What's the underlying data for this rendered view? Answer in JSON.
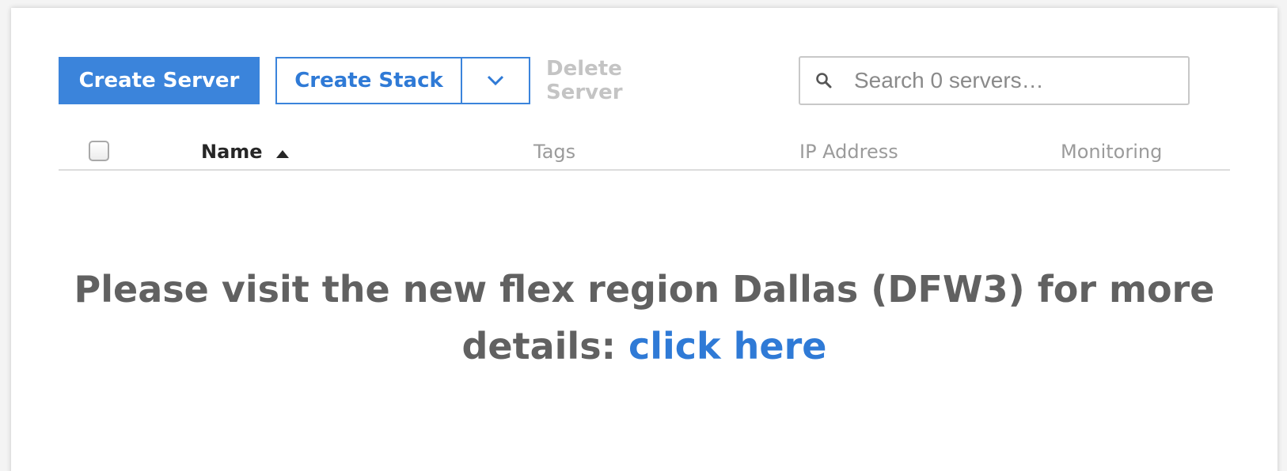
{
  "toolbar": {
    "create_server_label": "Create Server",
    "create_stack_label": "Create Stack",
    "delete_server_label": "Delete Server"
  },
  "search": {
    "placeholder": "Search 0 servers…",
    "value": ""
  },
  "table": {
    "columns": [
      "Name",
      "Tags",
      "IP Address",
      "Monitoring"
    ],
    "sort_column": "Name",
    "sort_direction": "ascending",
    "rows": []
  },
  "notice": {
    "text": "Please visit the new flex region Dallas (DFW3) for more details:",
    "link_label": "click here"
  },
  "colors": {
    "accent": "#3b84db",
    "link": "#2f7ad6",
    "notice_text": "#616161",
    "disabled_text": "#c4c4c4"
  },
  "icons": {
    "search": "search-icon",
    "dropdown": "chevron-down-icon",
    "sort": "sort-ascending-icon"
  }
}
